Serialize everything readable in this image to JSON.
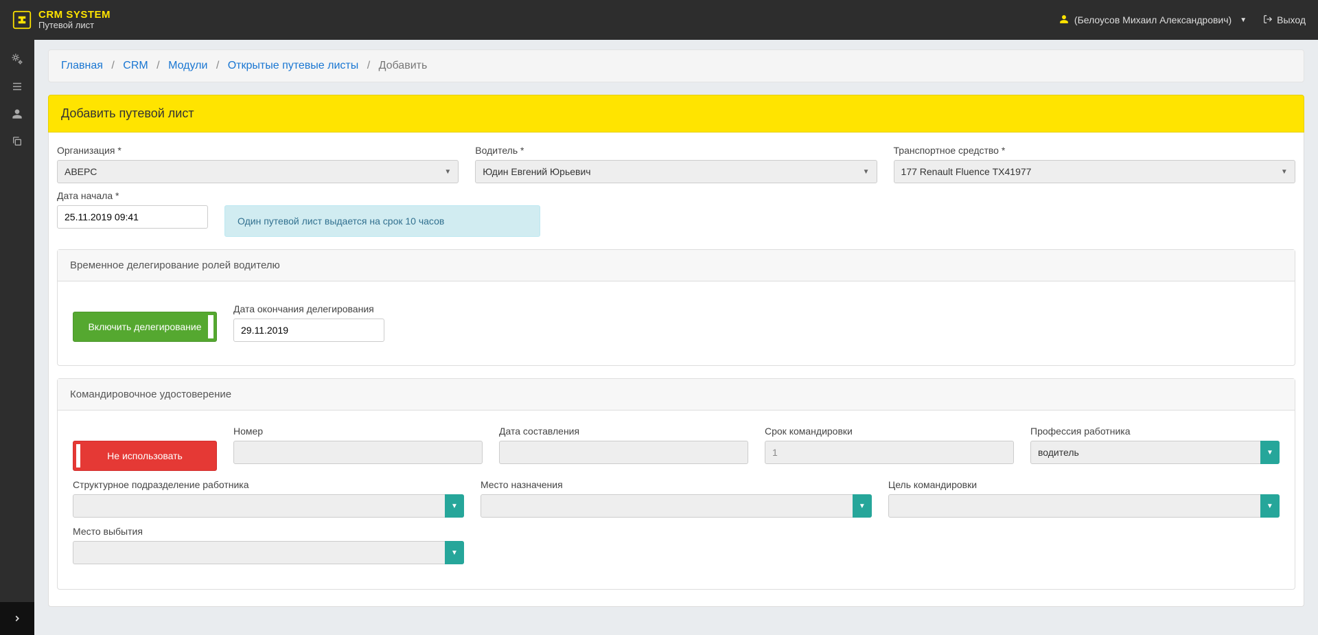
{
  "brand": {
    "title": "CRM SYSTEM",
    "subtitle": "Путевой лист"
  },
  "user": {
    "name": "(Белоусов Михаил Александрович)",
    "logout": "Выход"
  },
  "breadcrumbs": {
    "items": [
      {
        "label": "Главная"
      },
      {
        "label": "CRM"
      },
      {
        "label": "Модули"
      },
      {
        "label": "Открытые путевые листы"
      }
    ],
    "current": "Добавить"
  },
  "page_title": "Добавить путевой лист",
  "form": {
    "organization": {
      "label": "Организация *",
      "value": "АВЕРС"
    },
    "driver": {
      "label": "Водитель *",
      "value": "Юдин Евгений Юрьевич"
    },
    "vehicle": {
      "label": "Транспортное средство *",
      "value": "177 Renault Fluence ТХ41977"
    },
    "start_date": {
      "label": "Дата начала *",
      "value": "25.11.2019 09:41"
    },
    "info_note": "Один путевой лист выдается на срок 10 часов"
  },
  "delegation_panel": {
    "title": "Временное делегирование ролей водителю",
    "toggle_label": "Включить делегирование",
    "end_date": {
      "label": "Дата окончания делегирования",
      "value": "29.11.2019"
    }
  },
  "trip_cert_panel": {
    "title": "Командировочное удостоверение",
    "not_use_label": "Не использовать",
    "number": {
      "label": "Номер",
      "value": ""
    },
    "compose_date": {
      "label": "Дата составления",
      "value": ""
    },
    "period": {
      "label": "Срок командировки",
      "value": "1"
    },
    "profession": {
      "label": "Профессия работника",
      "value": "водитель"
    },
    "struct_unit": {
      "label": "Структурное подразделение работника",
      "value": ""
    },
    "destination": {
      "label": "Место назначения",
      "value": ""
    },
    "goal": {
      "label": "Цель командировки",
      "value": ""
    },
    "departure": {
      "label": "Место выбытия",
      "value": ""
    }
  }
}
